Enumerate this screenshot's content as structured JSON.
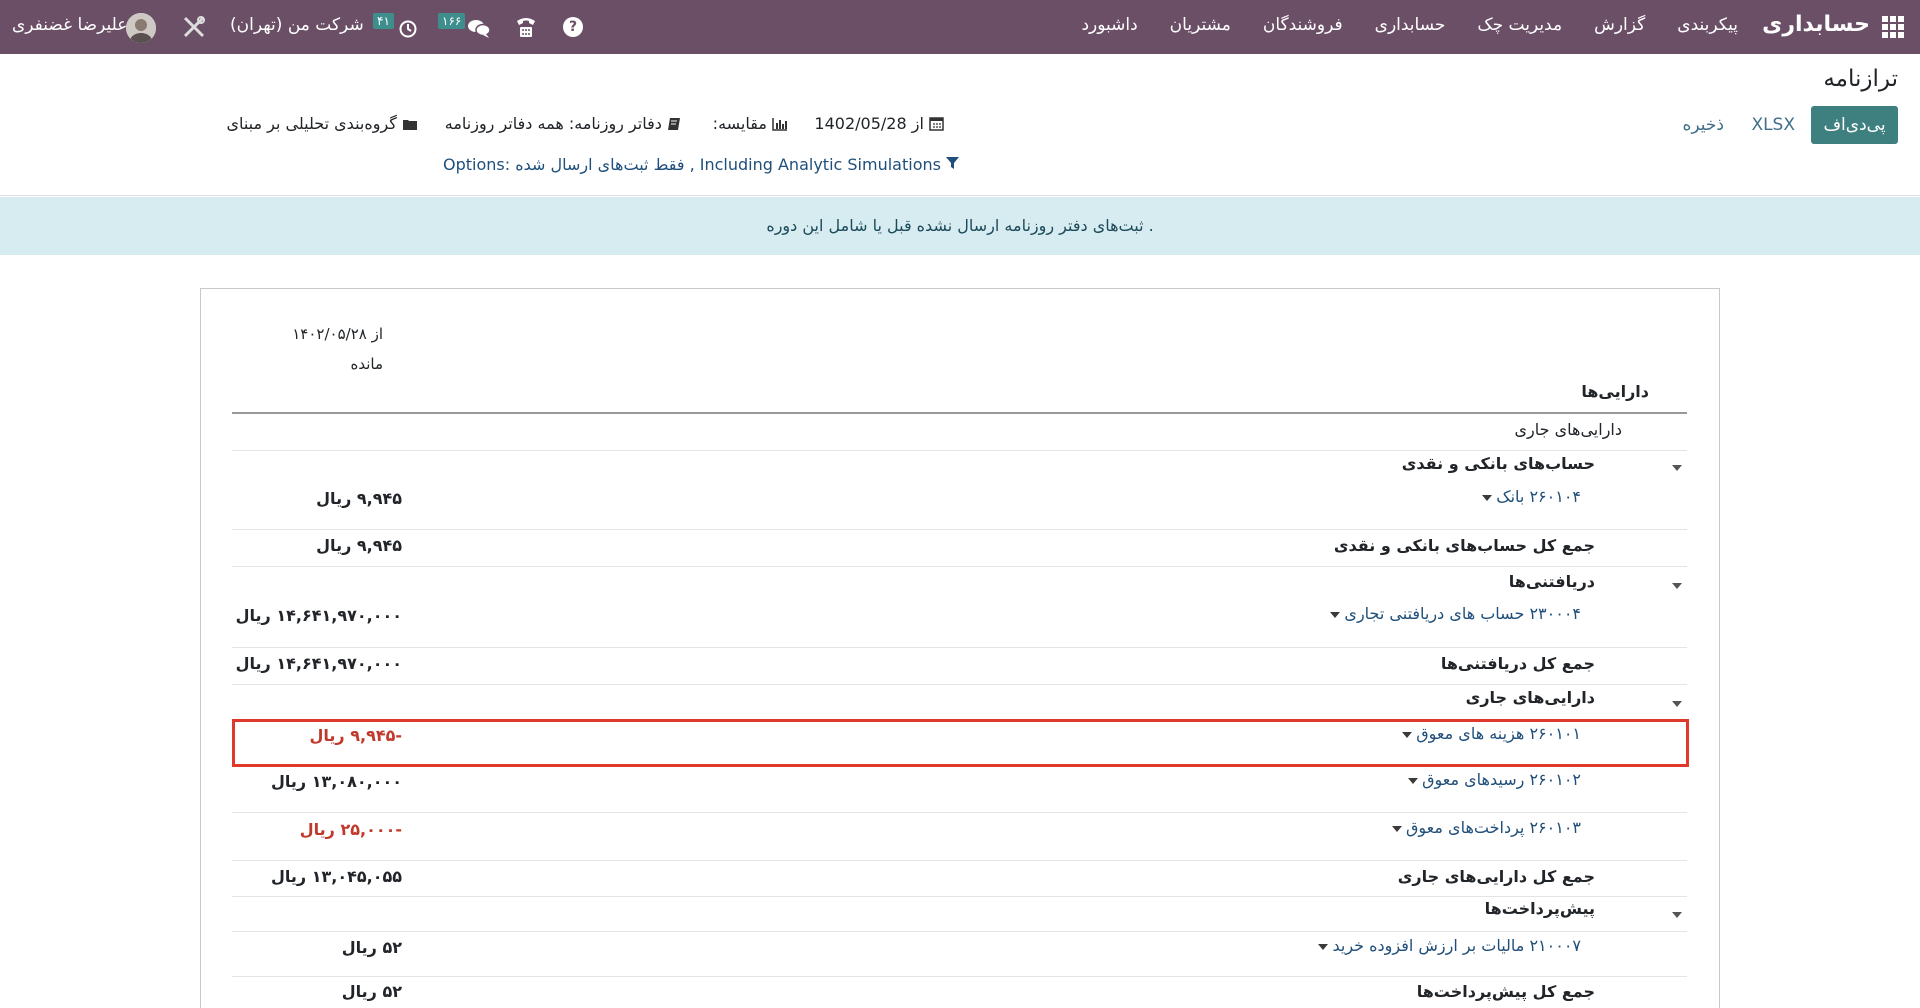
{
  "navbar": {
    "brand": "حسابداری",
    "menu": [
      "داشبورد",
      "مشتریان",
      "فروشندگان",
      "حسابداری",
      "مدیریت چک",
      "گزارش",
      "پیکربندی"
    ],
    "messages_badge": "۱۶۶",
    "activities_badge": "۴۱",
    "company": "شرکت من (تهران)",
    "username": "علیرضا غضنفری"
  },
  "control_panel": {
    "title": "ترازنامه",
    "pdf_button": "پی‌دی‌اف",
    "xlsx_button": "XLSX",
    "save_button": "ذخیره",
    "date_filter": "از 1402/05/28",
    "comparison_filter": "مقایسه:",
    "journals_filter": "دفاتر روزنامه: همه دفاتر روزنامه",
    "analytic_filter": "گروه‌بندی تحلیلی بر مبنای",
    "options_filter": "Options: فقط ثبت‌های ارسال شده , Including Analytic Simulations"
  },
  "info_banner": ". ثبت‌های دفتر روزنامه ارسال نشده قبل یا شامل این دوره",
  "report": {
    "column_header_line1": "از ۱۴۰۲/۰۵/۲۸",
    "column_header_line2": "مانده",
    "section_title": "دارایی‌ها",
    "rows": [
      {
        "label": "دارایی‌های جاری",
        "value": ""
      },
      {
        "label": "حساب‌های بانکی و نقدی",
        "value": ""
      },
      {
        "label": "۲۶۰۱۰۴ بانک",
        "value": "۹,۹۴۵ ریال"
      },
      {
        "label": "جمع کل حساب‌های بانکی و نقدی",
        "value": "۹,۹۴۵ ریال"
      },
      {
        "label": "دریافتنی‌ها",
        "value": ""
      },
      {
        "label": "۲۳۰۰۰۴ حساب های دریافتنی تجاری",
        "value": "۱۴,۶۴۱,۹۷۰,۰۰۰ ریال"
      },
      {
        "label": "جمع کل دریافتنی‌ها",
        "value": "۱۴,۶۴۱,۹۷۰,۰۰۰ ریال"
      },
      {
        "label": "دارایی‌های جاری",
        "value": ""
      },
      {
        "label": "۲۶۰۱۰۱ هزینه های معوق",
        "value": "-۹,۹۴۵ ریال"
      },
      {
        "label": "۲۶۰۱۰۲ رسیدهای معوق",
        "value": "۱۳,۰۸۰,۰۰۰ ریال"
      },
      {
        "label": "۲۶۰۱۰۳ پرداخت‌های معوق",
        "value": "-۲۵,۰۰۰ ریال"
      },
      {
        "label": "جمع کل دارایی‌های جاری",
        "value": "۱۳,۰۴۵,۰۵۵ ریال"
      },
      {
        "label": "پیش‌پرداخت‌ها",
        "value": ""
      },
      {
        "label": "۲۱۰۰۰۷ مالیات بر ارزش افزوده خرید",
        "value": "۵۲ ریال"
      },
      {
        "label": "جمع کل پیش‌پرداخت‌ها",
        "value": "۵۲ ریال"
      }
    ]
  },
  "colors": {
    "navbar": "#6b4f66",
    "primary_button": "#3e7f80",
    "banner": "#d6ecf0",
    "negative": "#c0392b",
    "highlight": "#e0392b"
  },
  "icons": [
    "apps-grid-icon",
    "help-icon",
    "phone-icon",
    "chat-icon",
    "clock-icon",
    "tools-icon",
    "calendar-icon",
    "chart-icon",
    "book-icon",
    "folder-icon",
    "filter-icon",
    "caret-down-icon"
  ]
}
